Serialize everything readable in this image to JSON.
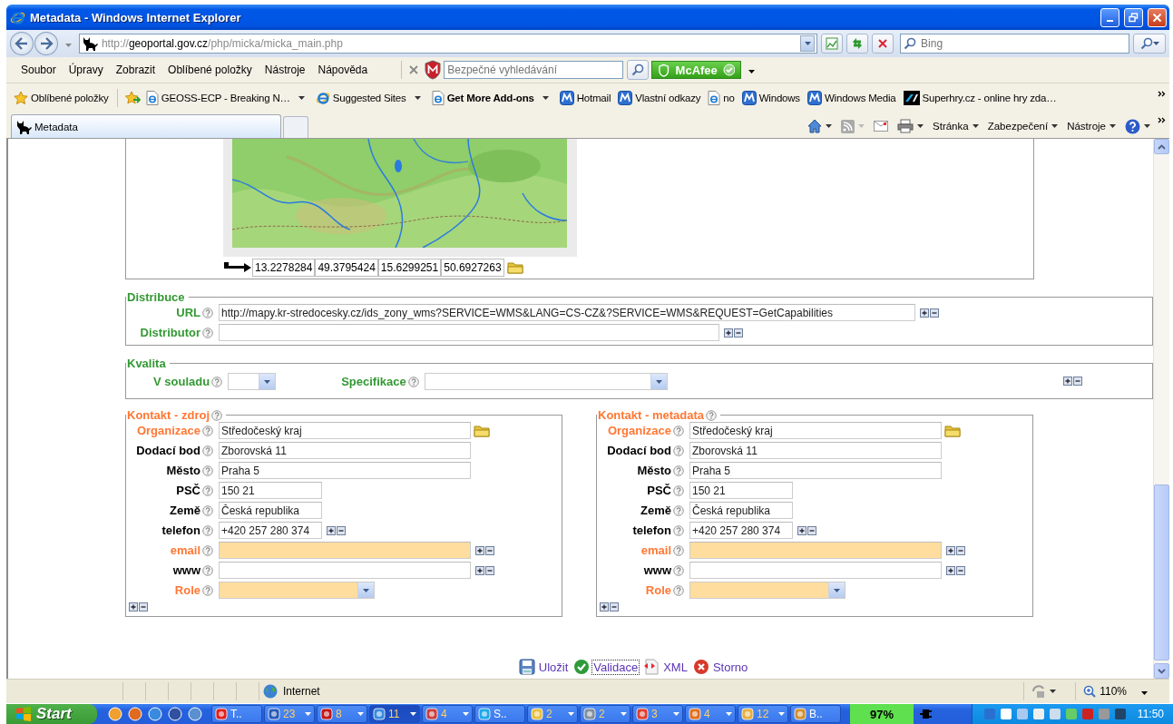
{
  "window": {
    "title": "Metadata - Windows Internet Explorer"
  },
  "address_bar": {
    "url_prefix": "http://",
    "url_host": "geoportal.gov.cz",
    "url_path": "/php/micka/micka_main.php"
  },
  "search": {
    "placeholder": "Bing"
  },
  "menu": [
    "Soubor",
    "Úpravy",
    "Zobrazit",
    "Oblíbené položky",
    "Nástroje",
    "Nápověda"
  ],
  "safe_search": {
    "placeholder": "Bezpečné vyhledávání"
  },
  "mcafee": {
    "label": "McAfee"
  },
  "favorites_bar": {
    "label": "Oblíbené položky",
    "items": [
      {
        "label": "GEOSS-ECP - Breaking N…",
        "kind": "iepage",
        "dropdown": true,
        "bold": false
      },
      {
        "label": "Suggested Sites",
        "kind": "ie",
        "dropdown": true,
        "bold": false
      },
      {
        "label": "Get More Add-ons",
        "kind": "iepage",
        "dropdown": true,
        "bold": true
      },
      {
        "label": "Hotmail",
        "kind": "tile",
        "dropdown": false,
        "bold": false
      },
      {
        "label": "Vlastní odkazy",
        "kind": "tile",
        "dropdown": false,
        "bold": false
      },
      {
        "label": "no",
        "kind": "iepage",
        "dropdown": false,
        "bold": false
      },
      {
        "label": "Windows",
        "kind": "tile",
        "dropdown": false,
        "bold": false
      },
      {
        "label": "Windows Media",
        "kind": "tile",
        "dropdown": false,
        "bold": false
      },
      {
        "label": "Superhry.cz - online hry zda…",
        "kind": "game",
        "dropdown": false,
        "bold": false
      }
    ]
  },
  "tabs": [
    {
      "label": "Metadata",
      "selected": true
    }
  ],
  "command_bar": [
    "Stránka",
    "Zabezpečení",
    "Nástroje"
  ],
  "extent": {
    "values": [
      "13.2278284",
      "49.3795424",
      "15.6299251",
      "50.6927263"
    ]
  },
  "distribuce": {
    "title": "Distribuce",
    "color": "#339933",
    "fields": [
      {
        "label": "URL",
        "kind": "wide",
        "value": "http://mapy.kr-stredocesky.cz/ids_zony_wms?SERVICE=WMS&LANG=CS-CZ&?SERVICE=WMS&REQUEST=GetCapabilities",
        "color": "#339933"
      },
      {
        "label": "Distributor",
        "kind": "medium",
        "color": "#339933"
      }
    ]
  },
  "kvalita": {
    "title": "Kvalita",
    "color": "#339933",
    "fields": [
      {
        "label": "V souladu",
        "kind": "select-small",
        "color": "#339933"
      },
      {
        "label": "Specifikace",
        "kind": "select",
        "color": "#339933"
      }
    ]
  },
  "contacts": [
    {
      "title": "Kontakt - zdroj",
      "color": "#ff7733",
      "fields": [
        {
          "label": "Organizace",
          "kind": "long",
          "value": "Středočeský kraj",
          "color": "#ff7733",
          "highlighted": false,
          "picker": true,
          "repeatable": false
        },
        {
          "label": "Dodací bod",
          "kind": "long",
          "value": "Zborovská 11",
          "color": "#000000",
          "highlighted": false,
          "picker": false,
          "repeatable": false
        },
        {
          "label": "Město",
          "kind": "long",
          "value": "Praha 5",
          "color": "#000000",
          "highlighted": false,
          "picker": false,
          "repeatable": false
        },
        {
          "label": "PSČ",
          "kind": "short",
          "value": "150 21",
          "color": "#000000",
          "highlighted": false,
          "picker": false,
          "repeatable": false
        },
        {
          "label": "Země",
          "kind": "short",
          "value": "Česká republika",
          "color": "#000000",
          "highlighted": false,
          "picker": false,
          "repeatable": false
        },
        {
          "label": "telefon",
          "kind": "short",
          "value": "+420 257 280 374",
          "color": "#000000",
          "highlighted": false,
          "picker": false,
          "repeatable": true
        },
        {
          "label": "email",
          "kind": "long",
          "color": "#ff7733",
          "highlighted": true,
          "picker": false,
          "repeatable": true
        },
        {
          "label": "www",
          "kind": "long",
          "color": "#000000",
          "highlighted": false,
          "picker": false,
          "repeatable": true
        },
        {
          "label": "Role",
          "kind": "select",
          "color": "#ff7733",
          "highlighted": true,
          "picker": false,
          "repeatable": false
        }
      ]
    },
    {
      "title": "Kontakt - metadata",
      "color": "#ff7733",
      "fields": [
        {
          "label": "Organizace",
          "kind": "long",
          "value": "Středočeský kraj",
          "color": "#ff7733",
          "highlighted": false,
          "picker": true,
          "repeatable": false
        },
        {
          "label": "Dodací bod",
          "kind": "long",
          "value": "Zborovská 11",
          "color": "#000000",
          "highlighted": false,
          "picker": false,
          "repeatable": false
        },
        {
          "label": "Město",
          "kind": "long",
          "value": "Praha 5",
          "color": "#000000",
          "highlighted": false,
          "picker": false,
          "repeatable": false
        },
        {
          "label": "PSČ",
          "kind": "short",
          "value": "150 21",
          "color": "#000000",
          "highlighted": false,
          "picker": false,
          "repeatable": false
        },
        {
          "label": "Země",
          "kind": "short",
          "value": "Česká republika",
          "color": "#000000",
          "highlighted": false,
          "picker": false,
          "repeatable": false
        },
        {
          "label": "telefon",
          "kind": "short",
          "value": "+420 257 280 374",
          "color": "#000000",
          "highlighted": false,
          "picker": false,
          "repeatable": true
        },
        {
          "label": "email",
          "kind": "long",
          "color": "#ff7733",
          "highlighted": true,
          "picker": false,
          "repeatable": true
        },
        {
          "label": "www",
          "kind": "long",
          "color": "#000000",
          "highlighted": false,
          "picker": false,
          "repeatable": true
        },
        {
          "label": "Role",
          "kind": "select",
          "color": "#ff7733",
          "highlighted": true,
          "picker": false,
          "repeatable": false
        }
      ]
    }
  ],
  "actions": [
    {
      "label": "Uložit",
      "kind": "save",
      "focused": false
    },
    {
      "label": "Validace",
      "kind": "check",
      "focused": true
    },
    {
      "label": "XML",
      "kind": "xml",
      "focused": false
    },
    {
      "label": "Storno",
      "kind": "cancel",
      "focused": false
    }
  ],
  "status_bar": {
    "zone": "Internet",
    "zoom": "110%"
  },
  "taskbar": {
    "start": "Start",
    "tasks": [
      {
        "label": "T..",
        "kind": "signal",
        "selected": false,
        "dropdown": false
      },
      {
        "label": "23",
        "kind": "word",
        "selected": false,
        "dropdown": true
      },
      {
        "label": "8",
        "kind": "pdf",
        "selected": false,
        "dropdown": true
      },
      {
        "label": "11",
        "kind": "ie",
        "selected": true,
        "dropdown": true
      },
      {
        "label": "4",
        "kind": "chart",
        "selected": false,
        "dropdown": true
      },
      {
        "label": "S..",
        "kind": "skype",
        "selected": false,
        "dropdown": false
      },
      {
        "label": "2",
        "kind": "folder",
        "selected": false,
        "dropdown": true
      },
      {
        "label": "2",
        "kind": "archive",
        "selected": false,
        "dropdown": true
      },
      {
        "label": "3",
        "kind": "camera",
        "selected": false,
        "dropdown": true
      },
      {
        "label": "4",
        "kind": "firefox",
        "selected": false,
        "dropdown": true
      },
      {
        "label": "12",
        "kind": "mail",
        "selected": false,
        "dropdown": true
      },
      {
        "label": "B..",
        "kind": "paint",
        "selected": false,
        "dropdown": false
      }
    ],
    "battery": "97%",
    "clock": "11:50"
  }
}
